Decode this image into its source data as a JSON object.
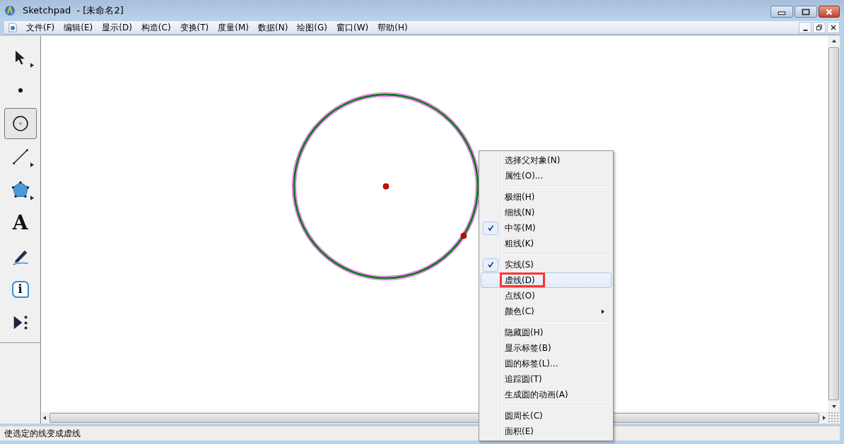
{
  "window": {
    "title": "Sketchpad  - [未命名2]"
  },
  "menu_bar": [
    {
      "label": "文件(F)"
    },
    {
      "label": "编辑(E)"
    },
    {
      "label": "显示(D)"
    },
    {
      "label": "构造(C)"
    },
    {
      "label": "变换(T)"
    },
    {
      "label": "度量(M)"
    },
    {
      "label": "数据(N)"
    },
    {
      "label": "绘图(G)"
    },
    {
      "label": "窗口(W)"
    },
    {
      "label": "帮助(H)"
    }
  ],
  "toolbox": [
    {
      "kind": "arrow",
      "selected": false,
      "has_submenu": true
    },
    {
      "kind": "point",
      "selected": false,
      "has_submenu": false
    },
    {
      "kind": "compass",
      "selected": true,
      "has_submenu": false
    },
    {
      "kind": "line",
      "selected": false,
      "has_submenu": true
    },
    {
      "kind": "polygon",
      "selected": false,
      "has_submenu": true
    },
    {
      "kind": "text",
      "selected": false,
      "has_submenu": false,
      "glyph": "A"
    },
    {
      "kind": "marker",
      "selected": false,
      "has_submenu": false
    },
    {
      "kind": "info",
      "selected": false,
      "has_submenu": false,
      "glyph": "i"
    },
    {
      "kind": "custom",
      "selected": false,
      "has_submenu": false
    }
  ],
  "context_menu": {
    "groups": [
      [
        {
          "label": "选择父对象(N)",
          "checked": false,
          "selected": false,
          "has_submenu": false,
          "annotated": false
        },
        {
          "label": "属性(O)...",
          "checked": false,
          "selected": false,
          "has_submenu": false,
          "annotated": false
        }
      ],
      [
        {
          "label": "极细(H)",
          "checked": false,
          "selected": false,
          "has_submenu": false,
          "annotated": false
        },
        {
          "label": "细线(N)",
          "checked": false,
          "selected": false,
          "has_submenu": false,
          "annotated": false
        },
        {
          "label": "中等(M)",
          "checked": true,
          "selected": false,
          "has_submenu": false,
          "annotated": false
        },
        {
          "label": "粗线(K)",
          "checked": false,
          "selected": false,
          "has_submenu": false,
          "annotated": false
        }
      ],
      [
        {
          "label": "实线(S)",
          "checked": true,
          "selected": false,
          "has_submenu": false,
          "annotated": false
        },
        {
          "label": "虚线(D)",
          "checked": false,
          "selected": true,
          "has_submenu": false,
          "annotated": true
        },
        {
          "label": "点线(O)",
          "checked": false,
          "selected": false,
          "has_submenu": false,
          "annotated": false
        },
        {
          "label": "颜色(C)",
          "checked": false,
          "selected": false,
          "has_submenu": true,
          "annotated": false
        }
      ],
      [
        {
          "label": "隐藏圆(H)",
          "checked": false,
          "selected": false,
          "has_submenu": false,
          "annotated": false
        },
        {
          "label": "显示标签(B)",
          "checked": false,
          "selected": false,
          "has_submenu": false,
          "annotated": false
        },
        {
          "label": "圆的标签(L)...",
          "checked": false,
          "selected": false,
          "has_submenu": false,
          "annotated": false
        },
        {
          "label": "追踪圆(T)",
          "checked": false,
          "selected": false,
          "has_submenu": false,
          "annotated": false
        },
        {
          "label": "生成圆的动画(A)",
          "checked": false,
          "selected": false,
          "has_submenu": false,
          "annotated": false
        }
      ],
      [
        {
          "label": "圆周长(C)",
          "checked": false,
          "selected": false,
          "has_submenu": false,
          "annotated": false
        },
        {
          "label": "面积(E)",
          "checked": false,
          "selected": false,
          "has_submenu": false,
          "annotated": false
        }
      ]
    ]
  },
  "canvas": {
    "circle": {
      "selected": true
    }
  },
  "status_bar": {
    "text": "使选定的线变成虚线"
  }
}
